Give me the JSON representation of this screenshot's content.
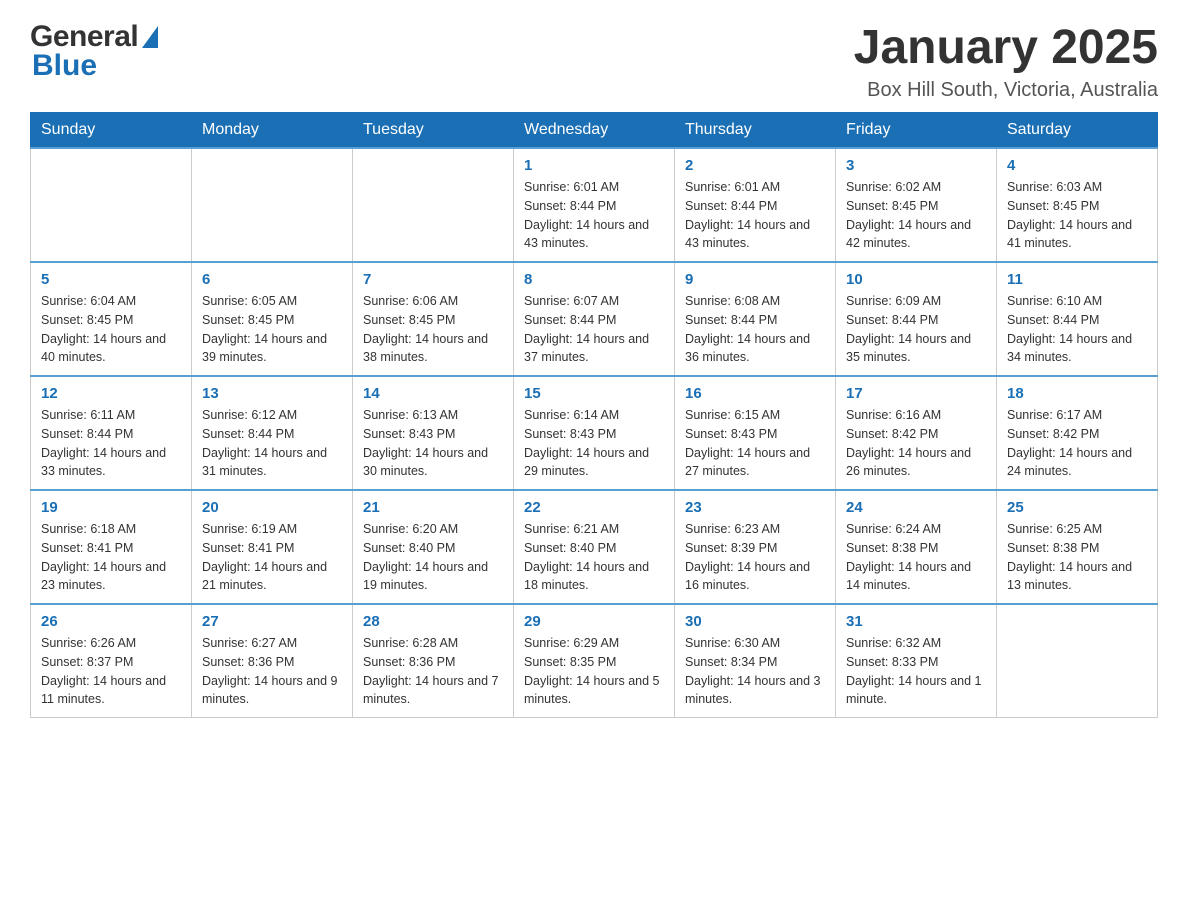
{
  "header": {
    "month_year": "January 2025",
    "location": "Box Hill South, Victoria, Australia"
  },
  "logo": {
    "general": "General",
    "blue": "Blue"
  },
  "days_of_week": [
    "Sunday",
    "Monday",
    "Tuesday",
    "Wednesday",
    "Thursday",
    "Friday",
    "Saturday"
  ],
  "weeks": [
    [
      {
        "day": "",
        "info": ""
      },
      {
        "day": "",
        "info": ""
      },
      {
        "day": "",
        "info": ""
      },
      {
        "day": "1",
        "info": "Sunrise: 6:01 AM\nSunset: 8:44 PM\nDaylight: 14 hours and 43 minutes."
      },
      {
        "day": "2",
        "info": "Sunrise: 6:01 AM\nSunset: 8:44 PM\nDaylight: 14 hours and 43 minutes."
      },
      {
        "day": "3",
        "info": "Sunrise: 6:02 AM\nSunset: 8:45 PM\nDaylight: 14 hours and 42 minutes."
      },
      {
        "day": "4",
        "info": "Sunrise: 6:03 AM\nSunset: 8:45 PM\nDaylight: 14 hours and 41 minutes."
      }
    ],
    [
      {
        "day": "5",
        "info": "Sunrise: 6:04 AM\nSunset: 8:45 PM\nDaylight: 14 hours and 40 minutes."
      },
      {
        "day": "6",
        "info": "Sunrise: 6:05 AM\nSunset: 8:45 PM\nDaylight: 14 hours and 39 minutes."
      },
      {
        "day": "7",
        "info": "Sunrise: 6:06 AM\nSunset: 8:45 PM\nDaylight: 14 hours and 38 minutes."
      },
      {
        "day": "8",
        "info": "Sunrise: 6:07 AM\nSunset: 8:44 PM\nDaylight: 14 hours and 37 minutes."
      },
      {
        "day": "9",
        "info": "Sunrise: 6:08 AM\nSunset: 8:44 PM\nDaylight: 14 hours and 36 minutes."
      },
      {
        "day": "10",
        "info": "Sunrise: 6:09 AM\nSunset: 8:44 PM\nDaylight: 14 hours and 35 minutes."
      },
      {
        "day": "11",
        "info": "Sunrise: 6:10 AM\nSunset: 8:44 PM\nDaylight: 14 hours and 34 minutes."
      }
    ],
    [
      {
        "day": "12",
        "info": "Sunrise: 6:11 AM\nSunset: 8:44 PM\nDaylight: 14 hours and 33 minutes."
      },
      {
        "day": "13",
        "info": "Sunrise: 6:12 AM\nSunset: 8:44 PM\nDaylight: 14 hours and 31 minutes."
      },
      {
        "day": "14",
        "info": "Sunrise: 6:13 AM\nSunset: 8:43 PM\nDaylight: 14 hours and 30 minutes."
      },
      {
        "day": "15",
        "info": "Sunrise: 6:14 AM\nSunset: 8:43 PM\nDaylight: 14 hours and 29 minutes."
      },
      {
        "day": "16",
        "info": "Sunrise: 6:15 AM\nSunset: 8:43 PM\nDaylight: 14 hours and 27 minutes."
      },
      {
        "day": "17",
        "info": "Sunrise: 6:16 AM\nSunset: 8:42 PM\nDaylight: 14 hours and 26 minutes."
      },
      {
        "day": "18",
        "info": "Sunrise: 6:17 AM\nSunset: 8:42 PM\nDaylight: 14 hours and 24 minutes."
      }
    ],
    [
      {
        "day": "19",
        "info": "Sunrise: 6:18 AM\nSunset: 8:41 PM\nDaylight: 14 hours and 23 minutes."
      },
      {
        "day": "20",
        "info": "Sunrise: 6:19 AM\nSunset: 8:41 PM\nDaylight: 14 hours and 21 minutes."
      },
      {
        "day": "21",
        "info": "Sunrise: 6:20 AM\nSunset: 8:40 PM\nDaylight: 14 hours and 19 minutes."
      },
      {
        "day": "22",
        "info": "Sunrise: 6:21 AM\nSunset: 8:40 PM\nDaylight: 14 hours and 18 minutes."
      },
      {
        "day": "23",
        "info": "Sunrise: 6:23 AM\nSunset: 8:39 PM\nDaylight: 14 hours and 16 minutes."
      },
      {
        "day": "24",
        "info": "Sunrise: 6:24 AM\nSunset: 8:38 PM\nDaylight: 14 hours and 14 minutes."
      },
      {
        "day": "25",
        "info": "Sunrise: 6:25 AM\nSunset: 8:38 PM\nDaylight: 14 hours and 13 minutes."
      }
    ],
    [
      {
        "day": "26",
        "info": "Sunrise: 6:26 AM\nSunset: 8:37 PM\nDaylight: 14 hours and 11 minutes."
      },
      {
        "day": "27",
        "info": "Sunrise: 6:27 AM\nSunset: 8:36 PM\nDaylight: 14 hours and 9 minutes."
      },
      {
        "day": "28",
        "info": "Sunrise: 6:28 AM\nSunset: 8:36 PM\nDaylight: 14 hours and 7 minutes."
      },
      {
        "day": "29",
        "info": "Sunrise: 6:29 AM\nSunset: 8:35 PM\nDaylight: 14 hours and 5 minutes."
      },
      {
        "day": "30",
        "info": "Sunrise: 6:30 AM\nSunset: 8:34 PM\nDaylight: 14 hours and 3 minutes."
      },
      {
        "day": "31",
        "info": "Sunrise: 6:32 AM\nSunset: 8:33 PM\nDaylight: 14 hours and 1 minute."
      },
      {
        "day": "",
        "info": ""
      }
    ]
  ]
}
